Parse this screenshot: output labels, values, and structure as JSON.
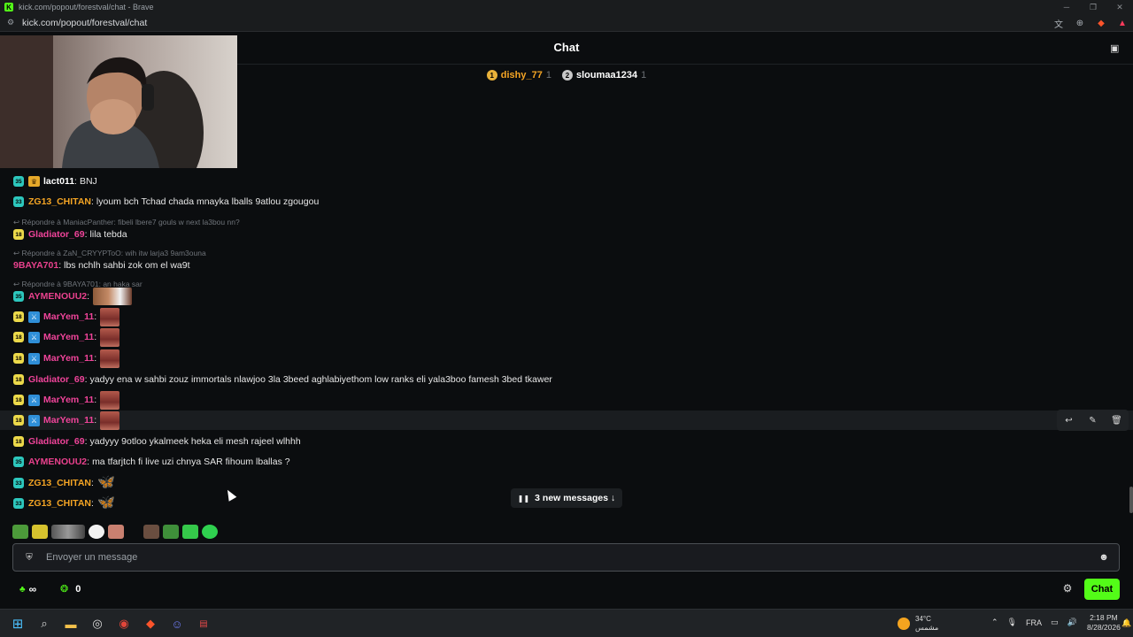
{
  "browser": {
    "window_title": "kick.com/popout/forestval/chat - Brave",
    "url": "kick.com/popout/forestval/chat"
  },
  "header": {
    "title": "Chat"
  },
  "leaderboard": [
    {
      "rank": "1",
      "name": "dishy_77",
      "count": "1",
      "color": "#f5a524"
    },
    {
      "rank": "2",
      "name": "sloumaa1234",
      "count": "1",
      "color": "#ffffff"
    }
  ],
  "messages": [
    {
      "badge": "35",
      "badge_color": "teal",
      "extra": "crown",
      "user": "lact011",
      "user_color": "white",
      "text": "BNJ"
    },
    {
      "badge": "33",
      "badge_color": "teal",
      "user": "ZG13_CHITAN",
      "user_color": "orange",
      "text": "lyoum bch Tchad chada mnayka lballs 9atlou zgougou"
    },
    {
      "reply": "Répondre à ManiacPanther: fibeli lbere7 gouls w next la3bou nn?"
    },
    {
      "badge": "18",
      "badge_color": "yellow",
      "user": "Gladiator_69",
      "user_color": "pink",
      "text": "lila tebda"
    },
    {
      "reply": "Répondre à ZaN_CRYYPToO: wih itw larja3 9am3ouna"
    },
    {
      "user": "9BAYA701",
      "user_color": "magenta",
      "text": "lbs nchlh sahbi zok om el wa9t"
    },
    {
      "reply": "Répondre à 9BAYA701: an haka sar"
    },
    {
      "badge": "35",
      "badge_color": "teal",
      "user": "AYMENOUU2",
      "user_color": "magenta",
      "emote": "wide"
    },
    {
      "badge": "18",
      "badge_color": "yellow",
      "extra": "sword",
      "user": "MarYem_11",
      "user_color": "pink",
      "emote": "sq"
    },
    {
      "badge": "18",
      "badge_color": "yellow",
      "extra": "sword",
      "user": "MarYem_11",
      "user_color": "pink",
      "emote": "sq"
    },
    {
      "badge": "18",
      "badge_color": "yellow",
      "extra": "sword",
      "user": "MarYem_11",
      "user_color": "pink",
      "emote": "sq"
    },
    {
      "badge": "18",
      "badge_color": "yellow",
      "user": "Gladiator_69",
      "user_color": "pink",
      "text": "yadyy ena w sahbi zouz immortals nlawjoo 3la 3beed aghlabiyethom low ranks eli yala3boo famesh 3bed tkawer"
    },
    {
      "badge": "18",
      "badge_color": "yellow",
      "extra": "sword",
      "user": "MarYem_11",
      "user_color": "pink",
      "emote": "sq"
    },
    {
      "badge": "18",
      "badge_color": "yellow",
      "extra": "sword",
      "user": "MarYem_11",
      "user_color": "pink",
      "emote": "sq",
      "highlight": true
    },
    {
      "badge": "18",
      "badge_color": "yellow",
      "user": "Gladiator_69",
      "user_color": "pink",
      "text": "yadyyy 9otloo ykalmeek heka eli mesh rajeel wlhhh"
    },
    {
      "badge": "35",
      "badge_color": "teal",
      "user": "AYMENOUU2",
      "user_color": "magenta",
      "text": "ma tfarjtch fi live uzi chnya SAR fihoum lballas ?"
    },
    {
      "badge": "33",
      "badge_color": "teal",
      "user": "ZG13_CHITAN",
      "user_color": "orange",
      "emote": "butterfly"
    },
    {
      "badge": "33",
      "badge_color": "teal",
      "user": "ZG13_CHITAN",
      "user_color": "orange",
      "emote": "butterfly"
    }
  ],
  "new_messages_label": "3 new messages ↓",
  "input": {
    "placeholder": "Envoyer un message"
  },
  "footer": {
    "points_value": "∞",
    "kicks_value": "0",
    "chat_button": "Chat"
  },
  "taskbar": {
    "weather_temp": "34°C",
    "weather_desc": "مشمس",
    "lang": "FRA",
    "time": "2:18 PM",
    "date": "8/28/2026",
    "discord_badge": "25"
  }
}
